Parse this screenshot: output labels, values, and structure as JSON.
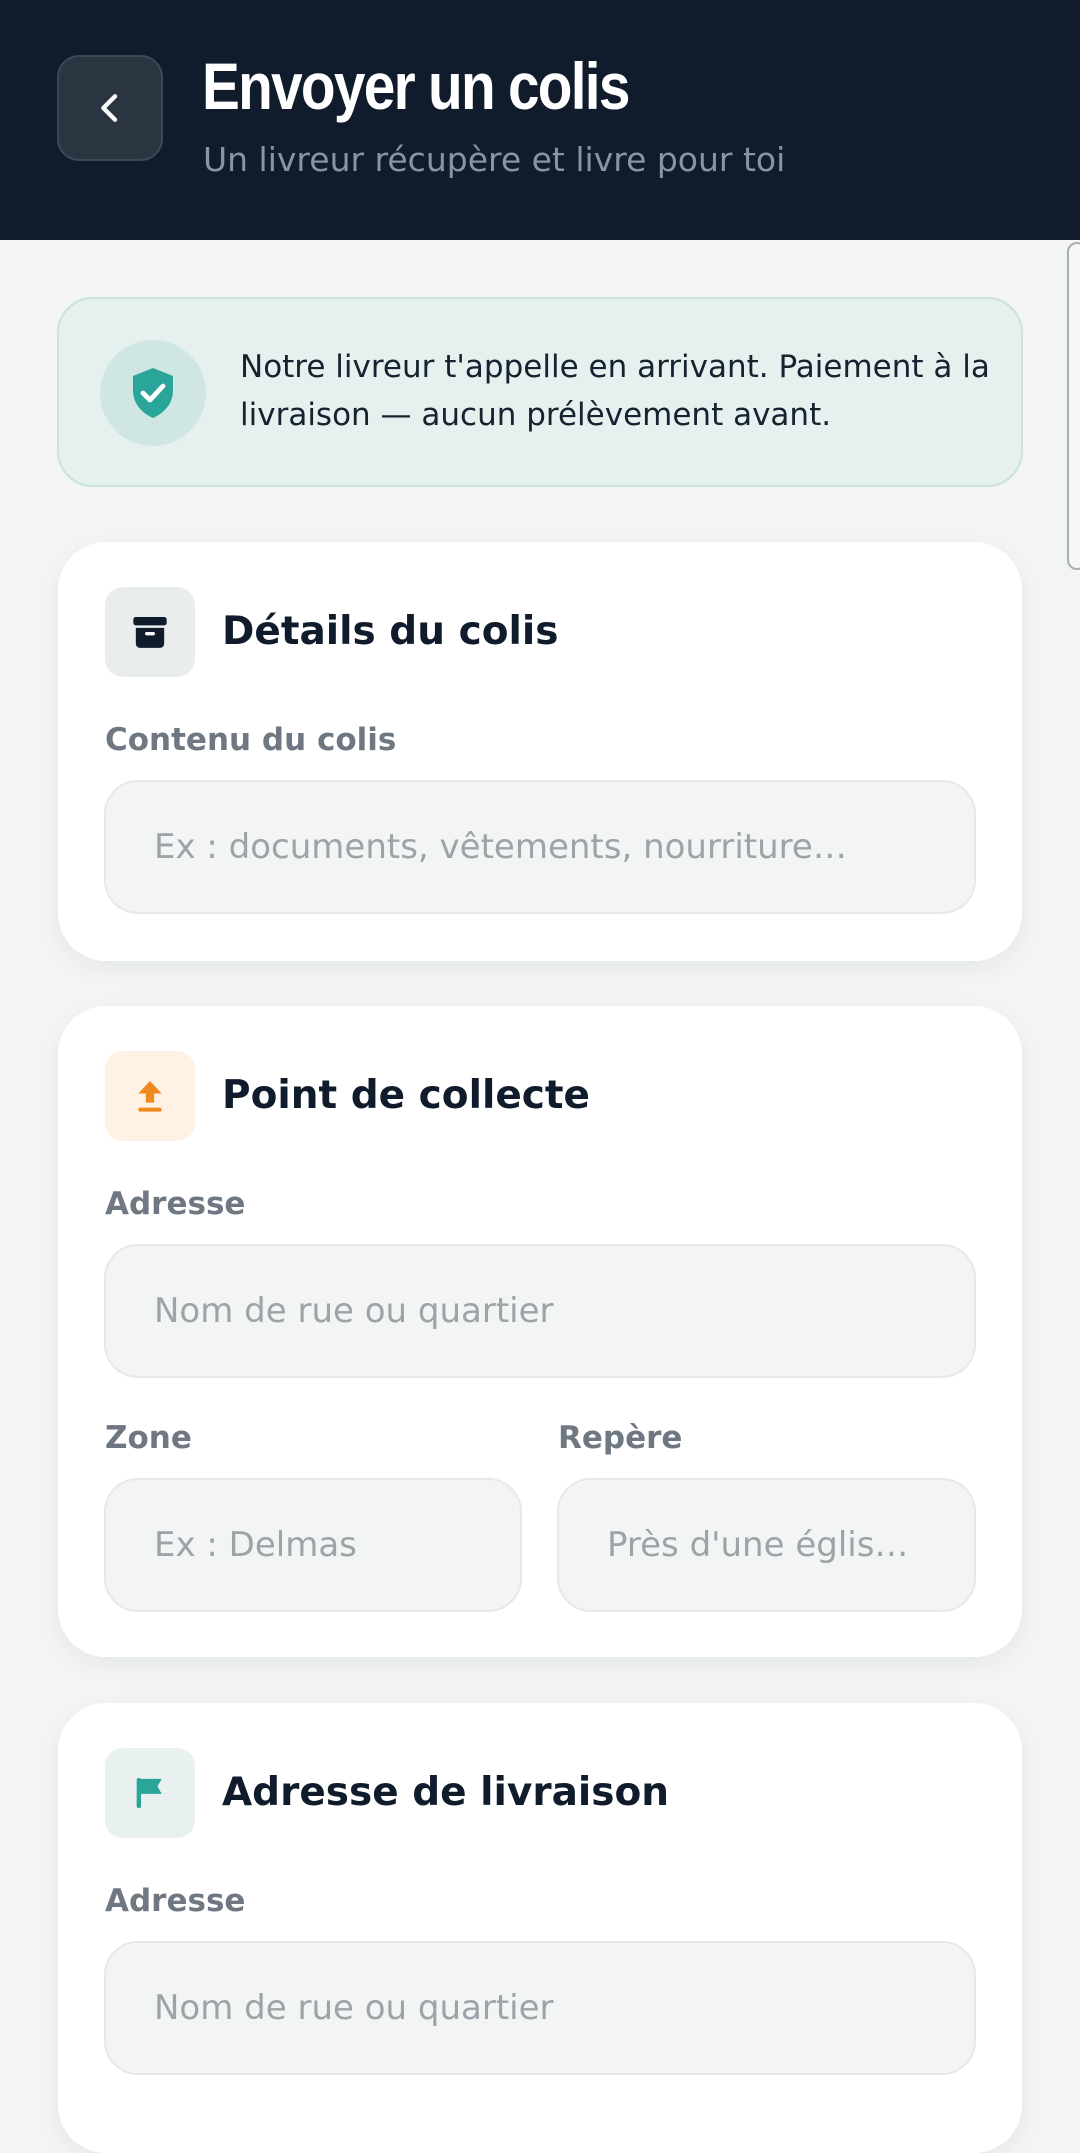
{
  "header": {
    "title": "Envoyer un colis",
    "subtitle": "Un livreur récupère et livre pour toi",
    "back_icon": "chevron-left-icon",
    "background": "#101b2c"
  },
  "notice": {
    "text": "Notre livreur t'appelle en arrivant. Paiement à la livraison — aucun prélèvement avant.",
    "icon": "shield-check-icon",
    "accent": "#2aa59a"
  },
  "sections": {
    "package": {
      "title": "Détails du colis",
      "icon": "archive-box-icon",
      "content_label": "Contenu du colis",
      "content_placeholder": "Ex : documents, vêtements, nourriture…",
      "content_value": ""
    },
    "pickup": {
      "title": "Point de collecte",
      "icon": "upload-arrow-icon",
      "accent": "#f08a1c",
      "address_label": "Adresse",
      "address_placeholder": "Nom de rue ou quartier",
      "zone_label": "Zone",
      "zone_placeholder": "Ex : Delmas",
      "landmark_label": "Repère",
      "landmark_placeholder": "Près d'une églis…"
    },
    "delivery": {
      "title": "Adresse de livraison",
      "icon": "flag-icon",
      "accent": "#2aa59a",
      "address_label": "Adresse",
      "address_placeholder": "Nom de rue ou quartier"
    }
  }
}
